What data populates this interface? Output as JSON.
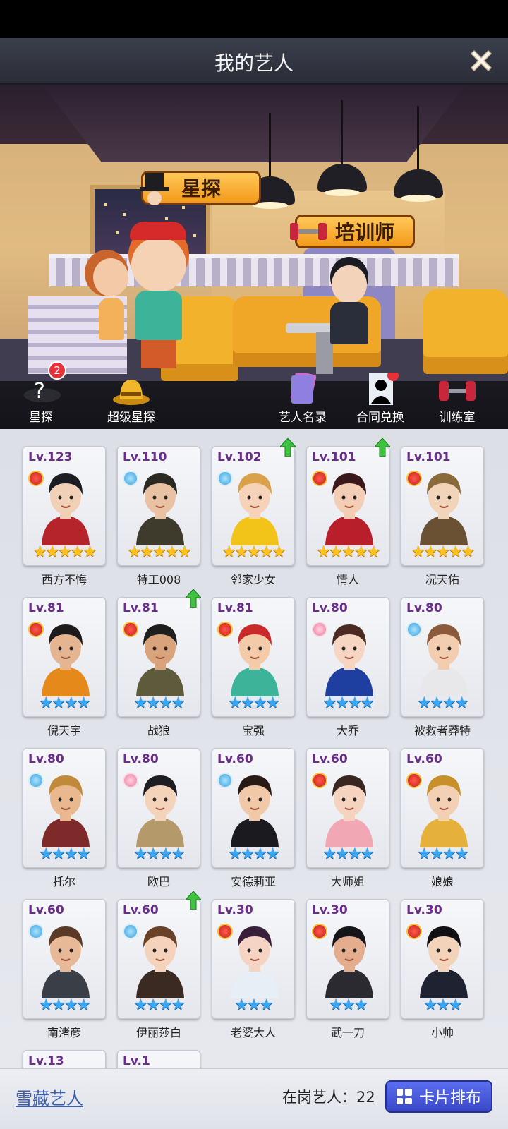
{
  "header": {
    "title": "我的艺人"
  },
  "scene": {
    "scout_sign": "星探",
    "trainer_sign": "培训师"
  },
  "toolbar": {
    "items": [
      {
        "label": "星探",
        "badge": "2"
      },
      {
        "label": "超级星探"
      },
      {
        "label": "艺人名录"
      },
      {
        "label": "合同兑换"
      },
      {
        "label": "训练室"
      }
    ]
  },
  "artists": [
    {
      "level": "Lv.123",
      "name": "西方不悔",
      "stars": "★★★★★",
      "star_color": "gold",
      "emblem": "red",
      "up": false
    },
    {
      "level": "Lv.110",
      "name": "特工008",
      "stars": "★★★★★",
      "star_color": "gold",
      "emblem": "blue",
      "up": false
    },
    {
      "level": "Lv.102",
      "name": "邻家少女",
      "stars": "★★★★★",
      "star_color": "gold",
      "emblem": "blue",
      "up": true
    },
    {
      "level": "Lv.101",
      "name": "情人",
      "stars": "★★★★★",
      "star_color": "gold",
      "emblem": "red",
      "up": true
    },
    {
      "level": "Lv.101",
      "name": "况天佑",
      "stars": "★★★★★",
      "star_color": "gold",
      "emblem": "red",
      "up": false
    },
    {
      "level": "Lv.81",
      "name": "倪天宇",
      "stars": "★★★★",
      "star_color": "blue",
      "emblem": "red",
      "up": false
    },
    {
      "level": "Lv.81",
      "name": "战狼",
      "stars": "★★★★",
      "star_color": "blue",
      "emblem": "red",
      "up": true
    },
    {
      "level": "Lv.81",
      "name": "宝强",
      "stars": "★★★★",
      "star_color": "blue",
      "emblem": "red",
      "up": false
    },
    {
      "level": "Lv.80",
      "name": "大乔",
      "stars": "★★★★",
      "star_color": "blue",
      "emblem": "pink",
      "up": false
    },
    {
      "level": "Lv.80",
      "name": "被救者莽特",
      "stars": "★★★★",
      "star_color": "blue",
      "emblem": "blue",
      "up": false
    },
    {
      "level": "Lv.80",
      "name": "托尔",
      "stars": "★★★★",
      "star_color": "blue",
      "emblem": "blue",
      "up": false
    },
    {
      "level": "Lv.80",
      "name": "欧巴",
      "stars": "★★★★",
      "star_color": "blue",
      "emblem": "pink",
      "up": false
    },
    {
      "level": "Lv.60",
      "name": "安德莉亚",
      "stars": "★★★★",
      "star_color": "blue",
      "emblem": "blue",
      "up": false
    },
    {
      "level": "Lv.60",
      "name": "大师姐",
      "stars": "★★★★",
      "star_color": "blue",
      "emblem": "red",
      "up": false
    },
    {
      "level": "Lv.60",
      "name": "娘娘",
      "stars": "★★★★",
      "star_color": "blue",
      "emblem": "red",
      "up": false
    },
    {
      "level": "Lv.60",
      "name": "南渚彦",
      "stars": "★★★★",
      "star_color": "blue",
      "emblem": "blue",
      "up": false
    },
    {
      "level": "Lv.60",
      "name": "伊丽莎白",
      "stars": "★★★★",
      "star_color": "blue",
      "emblem": "blue",
      "up": true
    },
    {
      "level": "Lv.30",
      "name": "老婆大人",
      "stars": "★★★",
      "star_color": "blue",
      "emblem": "red",
      "up": false
    },
    {
      "level": "Lv.30",
      "name": "武一刀",
      "stars": "★★★",
      "star_color": "blue",
      "emblem": "red",
      "up": false
    },
    {
      "level": "Lv.30",
      "name": "小帅",
      "stars": "★★★",
      "star_color": "blue",
      "emblem": "red",
      "up": false
    },
    {
      "level": "Lv.13",
      "name": "",
      "stars": "",
      "star_color": "blue",
      "emblem": "none",
      "up": false
    },
    {
      "level": "Lv.1",
      "name": "",
      "stars": "",
      "star_color": "blue",
      "emblem": "none",
      "up": false
    }
  ],
  "footer": {
    "snow_link": "雪藏艺人",
    "count_label": "在岗艺人：",
    "count_value": "22",
    "sort_button": "卡片排布"
  },
  "colors": {
    "accent": "#3a48c8",
    "level_text": "#6a2d8a",
    "gold_star": "#ffc21a",
    "blue_star": "#3aa5f2"
  }
}
